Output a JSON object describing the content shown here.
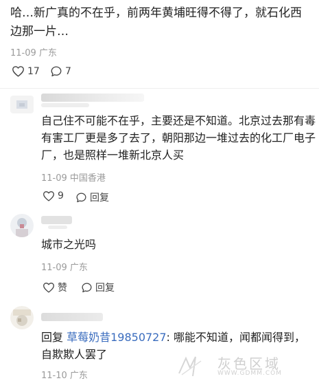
{
  "post": {
    "text": "哈…新广真的不在乎，前两年黄埔旺得不得了，就石化西边那一片…",
    "meta": "11-09 广东",
    "likes": "17",
    "comments": "7"
  },
  "comments": [
    {
      "text": "自己住不可能不在乎，主要还是不知道。北京过去那有毒有害工厂更是多了去了，朝阳那边一堆过去的化工厂电子厂，也是照样一堆新北京人买",
      "meta": "11-09 中国香港",
      "likes": "9",
      "reply_label": "回复"
    },
    {
      "text": "城市之光吗",
      "meta": "11-09 广东",
      "like_label": "赞",
      "reply_label": "回复"
    },
    {
      "reply_prefix": "回复 ",
      "reply_to": "草莓奶昔19850727",
      "text": ": 哪能不知道，闻都闻得到，自欺欺人罢了",
      "meta": "11-10 广东"
    }
  ],
  "watermark": {
    "logo_text": "灰色区域",
    "url_text": "WWW.GDMM.COM"
  },
  "colors": {
    "link": "#3a6cbe",
    "meta": "#9a9a9a"
  }
}
